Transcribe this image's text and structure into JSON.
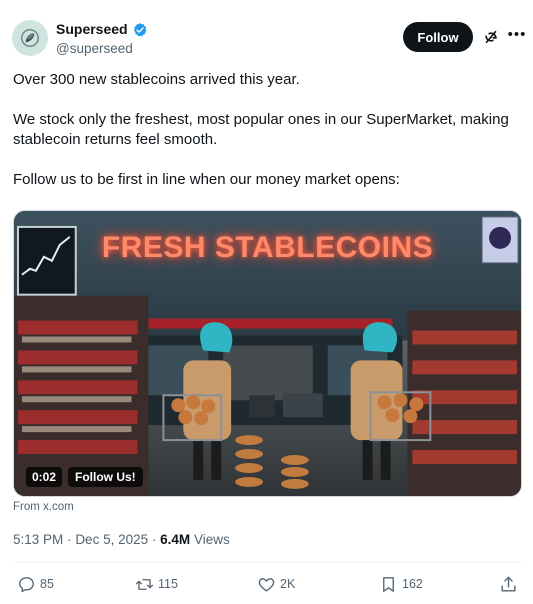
{
  "author": {
    "display_name": "Superseed",
    "handle": "@superseed",
    "verified": true,
    "avatar_icon": "seed-logo-icon"
  },
  "header_actions": {
    "follow_label": "Follow",
    "grok_icon": "grok-icon",
    "more_icon": "more-options-icon",
    "more_glyph": "•••"
  },
  "tweet": {
    "lines": [
      "Over 300 new stablecoins arrived this year.",
      "We stock only the freshest, most popular ones in our SuperMarket, making stablecoin returns feel smooth.",
      "Follow us to be first in line when our money market opens:"
    ]
  },
  "media": {
    "neon_sign": "FRESH STABLECOINS",
    "duration": "0:02",
    "cta_badge": "Follow Us!"
  },
  "source": "From x.com",
  "meta": {
    "time": "5:13 PM",
    "date": "Dec 5, 2025",
    "separator": "·",
    "views_count": "6.4M",
    "views_label": "Views"
  },
  "actions": {
    "replies": "85",
    "reposts": "115",
    "likes": "2K",
    "bookmarks": "162"
  },
  "colors": {
    "text_primary": "#0f1419",
    "text_secondary": "#536471",
    "verified_blue": "#1d9bf0",
    "follow_bg": "#0f1419",
    "neon": "#ff8a6b"
  }
}
